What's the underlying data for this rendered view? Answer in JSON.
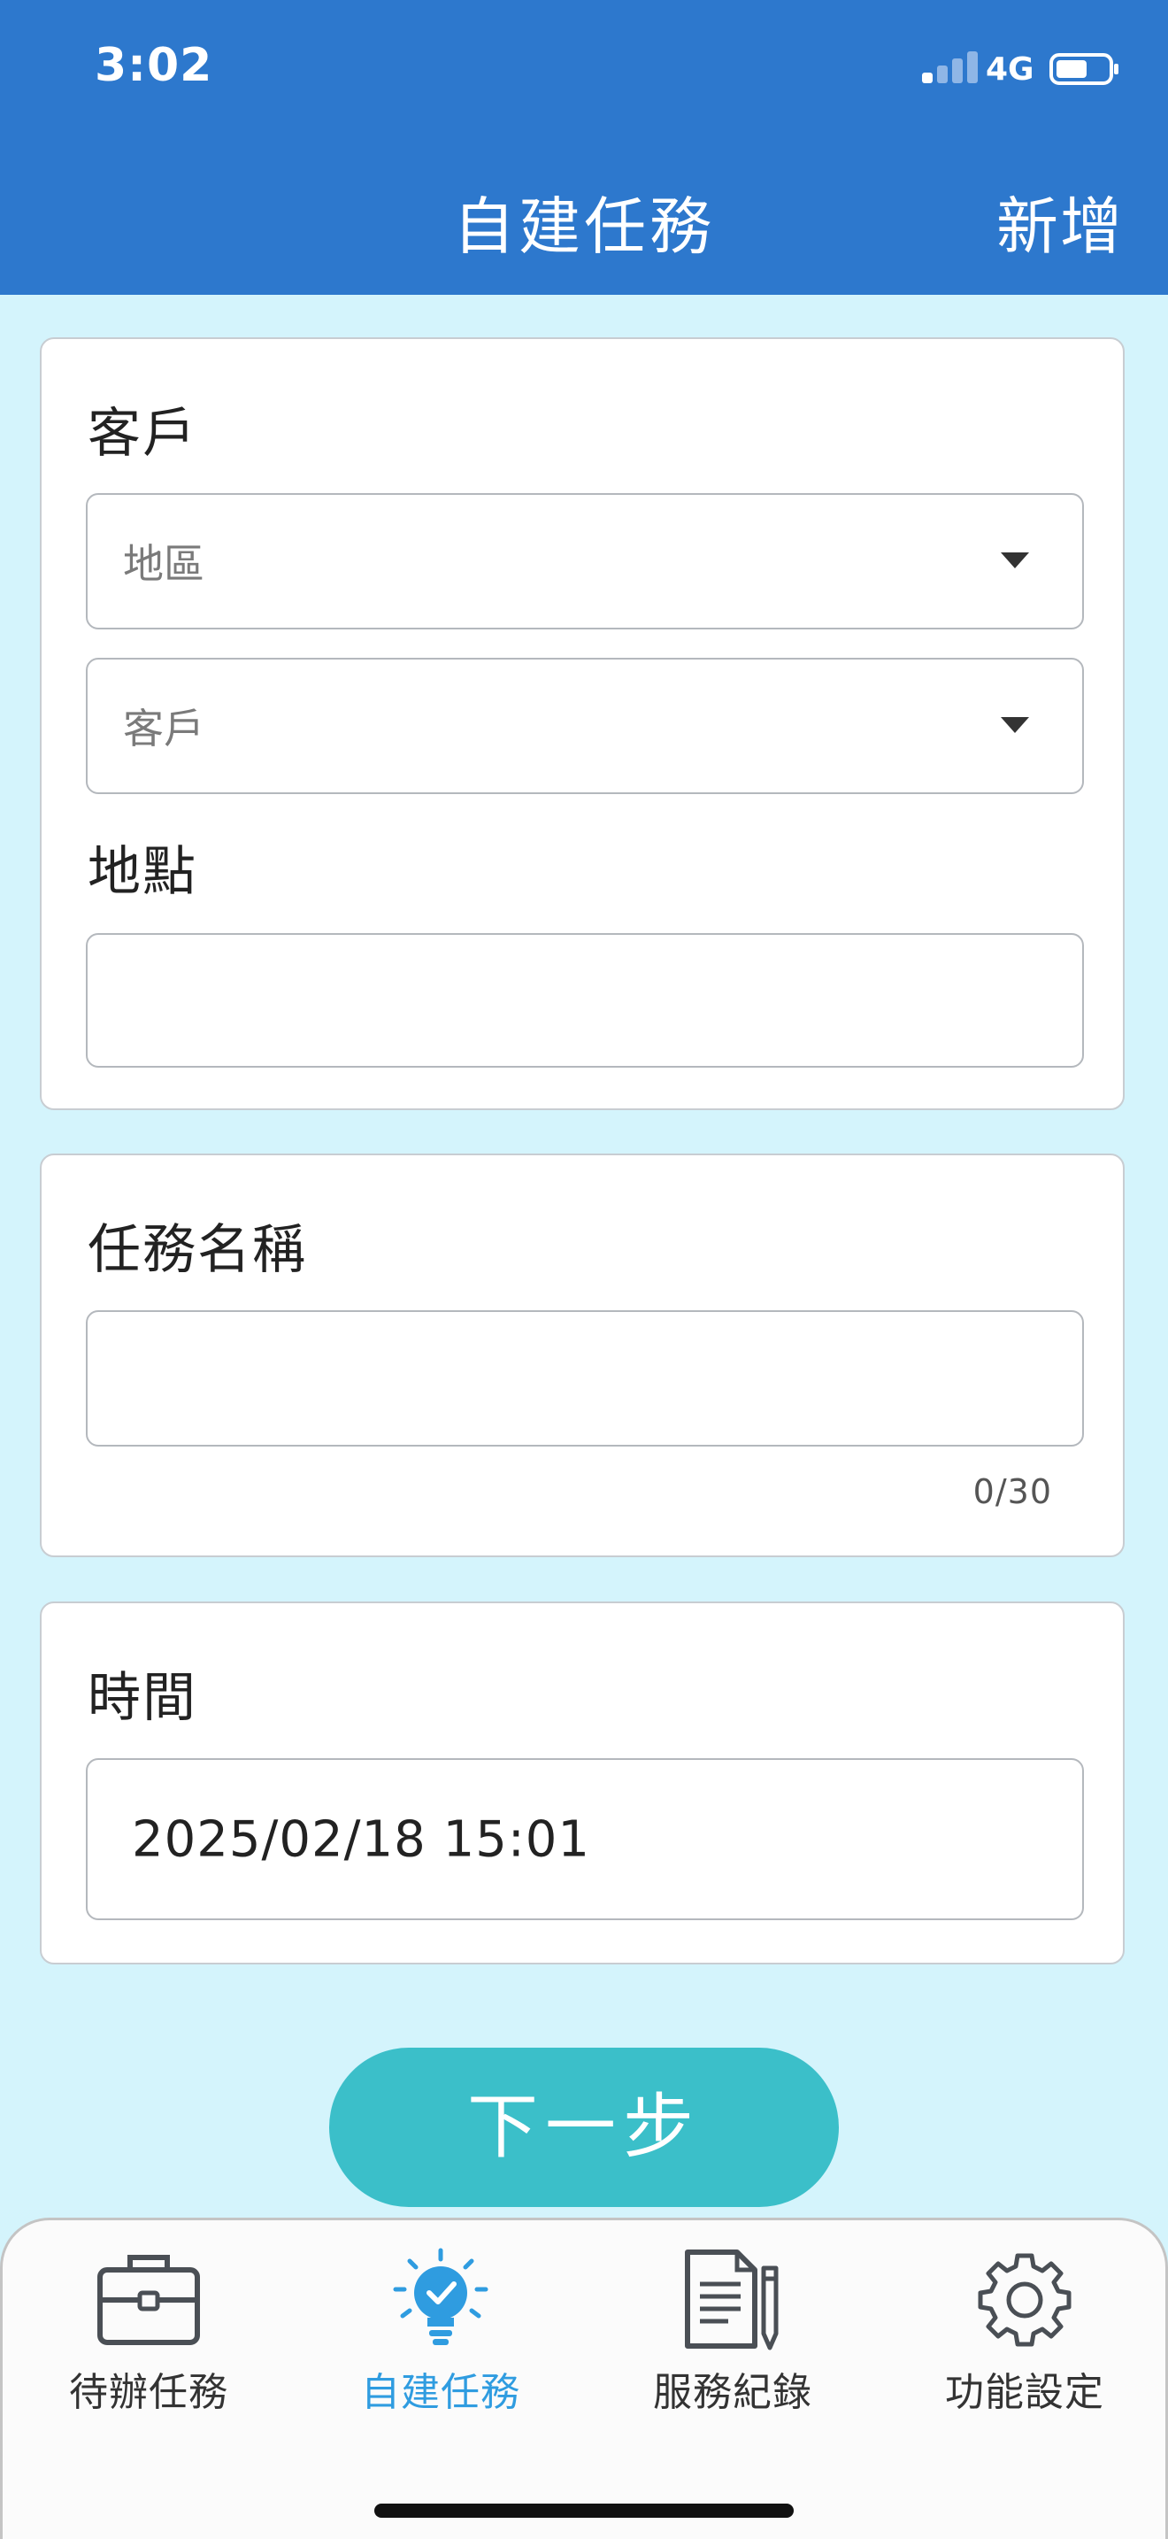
{
  "status_bar": {
    "time": "3:02",
    "network": "4G"
  },
  "nav": {
    "title": "自建任務",
    "add_label": "新增"
  },
  "customer_card": {
    "label": "客戶",
    "region_placeholder": "地區",
    "customer_placeholder": "客戶",
    "location_label": "地點",
    "location_value": ""
  },
  "task_card": {
    "label": "任務名稱",
    "name_value": "",
    "counter": "0/30"
  },
  "time_card": {
    "label": "時間",
    "value": "2025/02/18 15:01"
  },
  "next_button": {
    "label": "下一步"
  },
  "tabs": [
    {
      "label": "待辦任務",
      "icon": "briefcase-icon",
      "active": false
    },
    {
      "label": "自建任務",
      "icon": "lightbulb-check-icon",
      "active": true
    },
    {
      "label": "服務紀錄",
      "icon": "document-pen-icon",
      "active": false
    },
    {
      "label": "功能設定",
      "icon": "gear-icon",
      "active": false
    }
  ],
  "colors": {
    "header_blue": "#2d78cd",
    "page_bg": "#d4f4fc",
    "button_teal": "#3bbfc9",
    "active_tab": "#2f9ce0"
  }
}
